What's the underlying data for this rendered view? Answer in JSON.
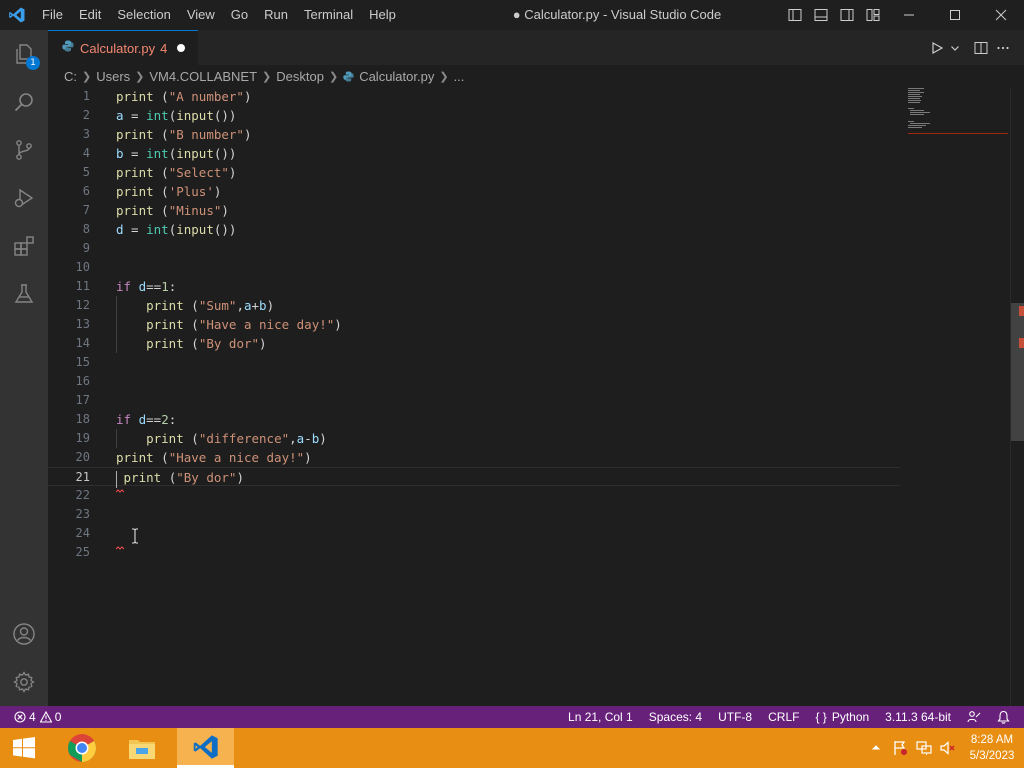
{
  "titlebar": {
    "menus": [
      "File",
      "Edit",
      "Selection",
      "View",
      "Go",
      "Run",
      "Terminal",
      "Help"
    ],
    "window_title": "● Calculator.py - Visual Studio Code"
  },
  "activitybar": {
    "explorer_badge": "1",
    "items": [
      "explorer-icon",
      "search-icon",
      "source-control-icon",
      "run-debug-icon",
      "extensions-icon",
      "testing-icon"
    ],
    "bottom_items": [
      "account-icon",
      "gear-icon"
    ]
  },
  "tab": {
    "name": "Calculator.py",
    "problem_count": "4",
    "modified": true
  },
  "breadcrumb": [
    "C:",
    "Users",
    "VM4.COLLABNET",
    "Desktop",
    "Calculator.py",
    "..."
  ],
  "editor": {
    "active_line": 21,
    "lines": [
      {
        "n": "1",
        "code": [
          [
            "fn",
            "print"
          ],
          [
            "",
            " ("
          ],
          [
            "str",
            "\"A number\""
          ],
          [
            "",
            ")"
          ]
        ]
      },
      {
        "n": "2",
        "code": [
          [
            "var",
            "a"
          ],
          [
            "",
            " = "
          ],
          [
            "bi",
            "int"
          ],
          [
            "",
            "("
          ],
          [
            "fn",
            "input"
          ],
          [
            "",
            "())"
          ]
        ]
      },
      {
        "n": "3",
        "code": [
          [
            "fn",
            "print"
          ],
          [
            "",
            " ("
          ],
          [
            "str",
            "\"B number\""
          ],
          [
            "",
            ")"
          ]
        ]
      },
      {
        "n": "4",
        "code": [
          [
            "var",
            "b"
          ],
          [
            "",
            " = "
          ],
          [
            "bi",
            "int"
          ],
          [
            "",
            "("
          ],
          [
            "fn",
            "input"
          ],
          [
            "",
            "())"
          ]
        ]
      },
      {
        "n": "5",
        "code": [
          [
            "fn",
            "print"
          ],
          [
            "",
            " ("
          ],
          [
            "str",
            "\"Select\""
          ],
          [
            "",
            ")"
          ]
        ]
      },
      {
        "n": "6",
        "code": [
          [
            "fn",
            "print"
          ],
          [
            "",
            " ("
          ],
          [
            "str",
            "'Plus'"
          ],
          [
            "",
            ")"
          ]
        ]
      },
      {
        "n": "7",
        "code": [
          [
            "fn",
            "print"
          ],
          [
            "",
            " ("
          ],
          [
            "str",
            "\"Minus\""
          ],
          [
            "",
            ")"
          ]
        ]
      },
      {
        "n": "8",
        "code": [
          [
            "var",
            "d"
          ],
          [
            "",
            " = "
          ],
          [
            "bi",
            "int"
          ],
          [
            "",
            "("
          ],
          [
            "fn",
            "input"
          ],
          [
            "",
            "())"
          ]
        ]
      },
      {
        "n": "9",
        "code": []
      },
      {
        "n": "10",
        "code": []
      },
      {
        "n": "11",
        "code": [
          [
            "kw",
            "if"
          ],
          [
            "",
            " "
          ],
          [
            "var",
            "d"
          ],
          [
            "",
            "=="
          ],
          [
            "num",
            "1"
          ],
          [
            "",
            ":"
          ]
        ]
      },
      {
        "n": "12",
        "code": [
          [
            "",
            "    "
          ],
          [
            "fn",
            "print"
          ],
          [
            "",
            " ("
          ],
          [
            "str",
            "\"Sum\""
          ],
          [
            "",
            ","
          ],
          [
            "var",
            "a"
          ],
          [
            "",
            "+"
          ],
          [
            "var",
            "b"
          ],
          [
            "",
            ")"
          ]
        ]
      },
      {
        "n": "13",
        "code": [
          [
            "",
            "    "
          ],
          [
            "fn",
            "print"
          ],
          [
            "",
            " ("
          ],
          [
            "str",
            "\"Have a nice day!\""
          ],
          [
            "",
            ")"
          ]
        ]
      },
      {
        "n": "14",
        "code": [
          [
            "",
            "    "
          ],
          [
            "fn",
            "print"
          ],
          [
            "",
            " ("
          ],
          [
            "str",
            "\"By dor\""
          ],
          [
            "",
            ")"
          ]
        ]
      },
      {
        "n": "15",
        "code": []
      },
      {
        "n": "16",
        "code": []
      },
      {
        "n": "17",
        "code": []
      },
      {
        "n": "18",
        "code": [
          [
            "kw",
            "if"
          ],
          [
            "",
            " "
          ],
          [
            "var",
            "d"
          ],
          [
            "",
            "=="
          ],
          [
            "num",
            "2"
          ],
          [
            "",
            ":"
          ]
        ]
      },
      {
        "n": "19",
        "code": [
          [
            "",
            "    "
          ],
          [
            "fn",
            "print"
          ],
          [
            "",
            " ("
          ],
          [
            "str",
            "\"difference\""
          ],
          [
            "",
            ","
          ],
          [
            "var",
            "a"
          ],
          [
            "",
            "-"
          ],
          [
            "var",
            "b"
          ],
          [
            "",
            ")"
          ]
        ]
      },
      {
        "n": "20",
        "code": [
          [
            "fn",
            "print"
          ],
          [
            "",
            " ("
          ],
          [
            "str",
            "\"Have a nice day!\""
          ],
          [
            "",
            ")"
          ]
        ]
      },
      {
        "n": "21",
        "code": [
          [
            "",
            " "
          ],
          [
            "fn",
            "print"
          ],
          [
            "",
            " ("
          ],
          [
            "str",
            "\"By dor\""
          ],
          [
            "",
            ")"
          ]
        ]
      },
      {
        "n": "22",
        "code": []
      },
      {
        "n": "23",
        "code": []
      },
      {
        "n": "24",
        "code": []
      },
      {
        "n": "25",
        "code": []
      }
    ]
  },
  "statusbar": {
    "errors": "4",
    "warnings": "0",
    "position": "Ln 21, Col 1",
    "spaces": "Spaces: 4",
    "encoding": "UTF-8",
    "eol": "CRLF",
    "language": "Python",
    "interpreter": "3.11.3 64-bit"
  },
  "taskbar": {
    "apps": [
      "windows-start-icon",
      "chrome-icon",
      "file-explorer-icon",
      "vscode-icon"
    ],
    "time": "8:28 AM",
    "date": "5/3/2023"
  },
  "colors": {
    "accent": "#0078d4",
    "statusbar": "#68217a",
    "taskbar": "#e88e12",
    "error": "#f48771"
  }
}
